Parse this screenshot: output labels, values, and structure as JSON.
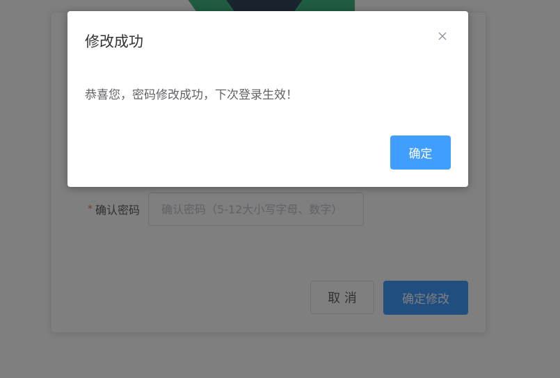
{
  "background": {
    "form": {
      "confirm_password": {
        "required_mark": "*",
        "label": "确认密码",
        "placeholder": "确认密码（5-12大小写字母、数字）"
      },
      "cancel_label": "取 消",
      "submit_label": "确定修改"
    }
  },
  "dialog": {
    "title": "修改成功",
    "message": "恭喜您，密码修改成功，下次登录生效！",
    "confirm_label": "确定"
  },
  "colors": {
    "primary": "#409eff",
    "danger": "#f56c6c",
    "logo_green": "#41b883",
    "logo_dark": "#34495e"
  }
}
